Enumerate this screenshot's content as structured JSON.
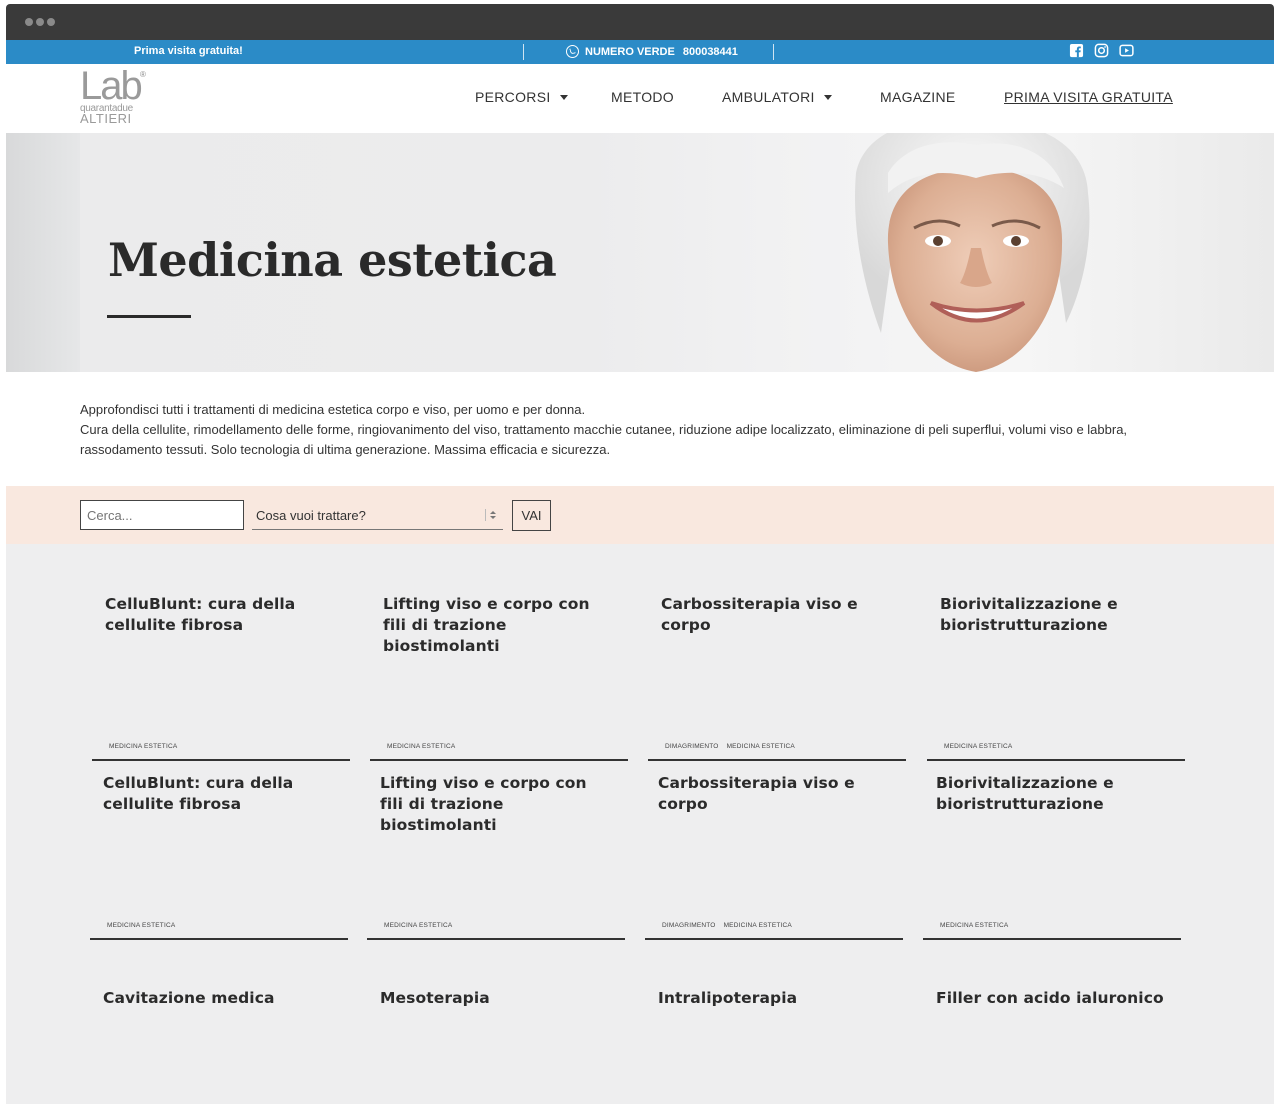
{
  "topbar": {
    "promo": "Prima visita gratuita!",
    "phone_label": "NUMERO VERDE",
    "phone_number": "800038441"
  },
  "logo": {
    "lab": "Lab",
    "reg": "®",
    "sub": "quarantadue",
    "brand": "ALTIERI"
  },
  "nav": {
    "items": [
      {
        "label": "PERCORSI"
      },
      {
        "label": "METODO"
      },
      {
        "label": "AMBULATORI"
      },
      {
        "label": "MAGAZINE"
      },
      {
        "label": "PRIMA VISITA GRATUITA"
      }
    ]
  },
  "hero": {
    "title": "Medicina estetica"
  },
  "intro": {
    "line1": "Approfondisci tutti i trattamenti di medicina estetica corpo e viso, per uomo e per donna.",
    "line2": "Cura della cellulite, rimodellamento delle forme, ringiovanimento del viso, trattamento macchie cutanee, riduzione adipe localizzato, eliminazione di peli superflui, volumi viso e labbra, rassodamento tessuti. Solo tecnologia di ultima generazione. Massima efficacia e sicurezza."
  },
  "search": {
    "placeholder": "Cerca...",
    "select_value": "Cosa vuoi trattare?",
    "button": "VAI"
  },
  "cards": [
    {
      "title": "CelluBlunt: cura della cellulite fibrosa",
      "tags": [
        "MEDICINA ESTETICA"
      ]
    },
    {
      "title": "Lifting viso e corpo con fili di trazione biostimolanti",
      "tags": [
        "MEDICINA ESTETICA"
      ]
    },
    {
      "title": "Carbossiterapia viso e corpo",
      "tags": [
        "DIMAGRIMENTO",
        "MEDICINA ESTETICA"
      ]
    },
    {
      "title": "Biorivitalizzazione e bioristrutturazione",
      "tags": [
        "MEDICINA ESTETICA"
      ]
    },
    {
      "title": "CelluBlunt: cura della cellulite fibrosa",
      "tags": [
        "MEDICINA ESTETICA"
      ]
    },
    {
      "title": "Lifting viso e corpo con fili di trazione biostimolanti",
      "tags": [
        "MEDICINA ESTETICA"
      ]
    },
    {
      "title": "Carbossiterapia viso e corpo",
      "tags": [
        "DIMAGRIMENTO",
        "MEDICINA ESTETICA"
      ]
    },
    {
      "title": "Biorivitalizzazione e bioristrutturazione",
      "tags": [
        "MEDICINA ESTETICA"
      ]
    },
    {
      "title": "Cavitazione medica",
      "tags": []
    },
    {
      "title": "Mesoterapia",
      "tags": []
    },
    {
      "title": "Intralipoterapia",
      "tags": []
    },
    {
      "title": "Filler con acido ialuronico",
      "tags": []
    }
  ],
  "colors": {
    "topbar": "#2b8bc7",
    "search_band": "#f9e8df",
    "grid_bg": "#eeeeef"
  },
  "icons": [
    "phone-icon",
    "facebook-icon",
    "instagram-icon",
    "youtube-icon",
    "caret-down-icon"
  ]
}
